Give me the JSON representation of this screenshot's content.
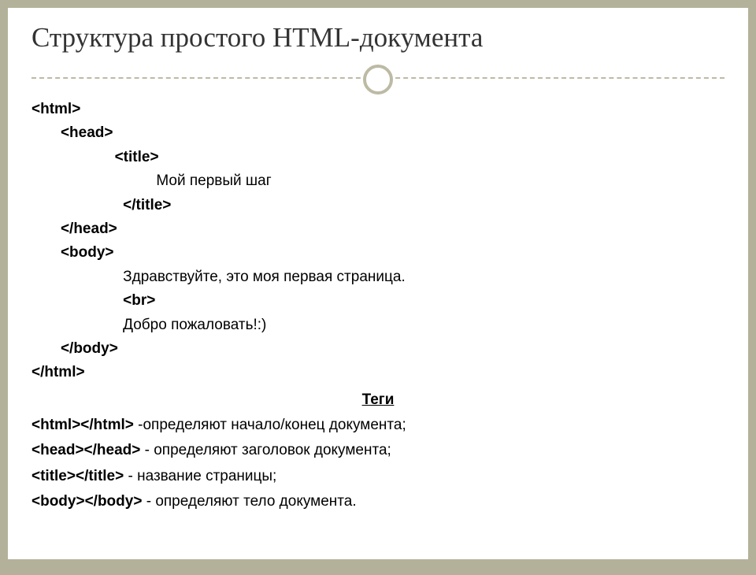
{
  "title": "Структура простого HTML-документа",
  "code": {
    "l1": "<html>",
    "l2": "       <head>",
    "l3": "                    <title>",
    "l4": "                              Мой первый шаг",
    "l5": "                      </title>",
    "l6": "       </head>",
    "l7": "       <body>",
    "l8": "                      Здравствуйте, это моя первая страница.",
    "l9": "                      <br>",
    "l10": "                      Добро пожаловать!:)",
    "l11": "       </body>",
    "l12": "</html>"
  },
  "tags_heading": "Теги",
  "desc": {
    "html_b": "<html></html>",
    "html_t": " -определяют начало/конец документа;",
    "head_b": "<head></head>",
    "head_t": " - определяют заголовок документа;",
    "title_b": "<title></title>",
    "title_t": " - название страницы;",
    "body_b": "<body></body>",
    "body_t": " - определяют тело документа."
  }
}
